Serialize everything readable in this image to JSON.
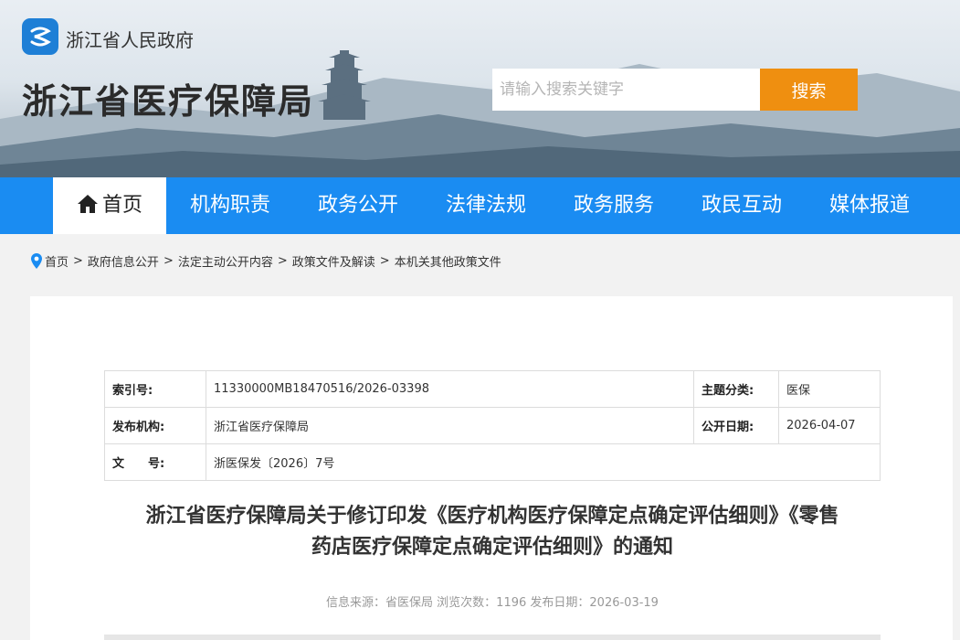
{
  "header": {
    "gov_name": "浙江省人民政府",
    "site_title": "浙江省医疗保障局",
    "search": {
      "placeholder": "请输入搜索关键字",
      "button_label": "搜索"
    }
  },
  "nav": {
    "items": [
      {
        "label": "首页"
      },
      {
        "label": "机构职责"
      },
      {
        "label": "政务公开"
      },
      {
        "label": "法律法规"
      },
      {
        "label": "政务服务"
      },
      {
        "label": "政民互动"
      },
      {
        "label": "媒体报道"
      }
    ]
  },
  "breadcrumb": {
    "items": [
      "首页",
      "政府信息公开",
      "法定主动公开内容",
      "政策文件及解读",
      "本机关其他政策文件"
    ],
    "separator": ">"
  },
  "meta": {
    "index_label": "索引号:",
    "index_value": "11330000MB18470516/2026-03398",
    "topic_label": "主题分类:",
    "topic_value": "医保",
    "publisher_label": "发布机构:",
    "publisher_value": "浙江省医疗保障局",
    "public_date_label": "公开日期:",
    "public_date_value": "2026-04-07",
    "doc_no_label": "文　　号:",
    "doc_no_value": "浙医保发〔2026〕7号"
  },
  "article": {
    "title_line1": "浙江省医疗保障局关于修订印发《医疗机构医疗保障定点确定评估细则》《零售",
    "title_line2": "药店医疗保障定点确定评估细则》的通知",
    "info": "信息来源：省医保局 浏览次数：1196 发布日期：2026-03-19"
  },
  "colors": {
    "nav_bg": "#1a8cf2",
    "search_btn": "#ef8f10",
    "logo_bg": "#1e7fd6"
  }
}
